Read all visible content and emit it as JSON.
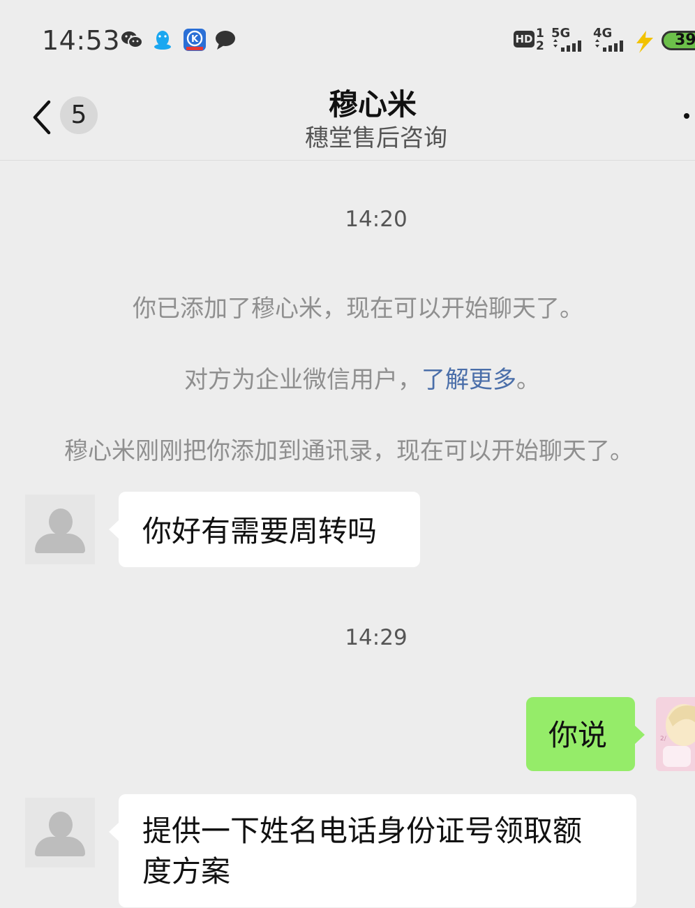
{
  "status_bar": {
    "time": "14:53",
    "notification_icons": [
      "wechat-icon",
      "qq-icon",
      "k-app-icon",
      "message-icon"
    ],
    "hd_label": "HD",
    "sim1_label": "1",
    "sim2_label": "2",
    "network1": "5G",
    "network2": "4G",
    "battery": "39"
  },
  "header": {
    "unread_count": "5",
    "contact_name": "穆心米",
    "subtitle": "穗堂售后咨询"
  },
  "chat": {
    "timestamp_1": "14:20",
    "system_1": "你已添加了穆心米，现在可以开始聊天了。",
    "system_2_prefix": "对方为企业微信用户，",
    "system_2_link": "了解更多",
    "system_2_suffix": "。",
    "system_3": "穆心米刚刚把你添加到通讯录，现在可以开始聊天了。",
    "message_1": "你好有需要周转吗",
    "timestamp_2": "14:29",
    "message_2": "你说",
    "message_3_line1": "提供一下姓名电话身份证号领取额",
    "message_3_line2": "度方案"
  },
  "colors": {
    "background": "#ededed",
    "incoming_bubble": "#ffffff",
    "outgoing_bubble": "#95ec69",
    "link": "#4a6ea9",
    "system_text": "#8f8f8f"
  }
}
